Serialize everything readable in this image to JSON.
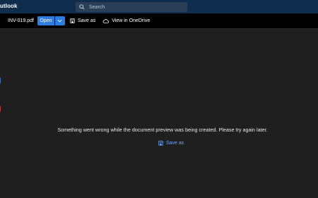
{
  "app": {
    "title": "utlook"
  },
  "search": {
    "placeholder": "Search",
    "icon": "search-icon"
  },
  "toolbar": {
    "file_name": "INV-019.pdf",
    "open_label": "Open",
    "save_as_label": "Save as",
    "view_onedrive_label": "View in OneDrive"
  },
  "preview": {
    "error_message": "Something went wrong while the document preview was being created. Please try again later.",
    "save_as_label": "Save as"
  },
  "colors": {
    "accent": "#2a7de1",
    "link": "#6aa8ff",
    "topbar": "#0f2e4d",
    "toolbar": "#000000",
    "background": "#1f1f1f"
  }
}
